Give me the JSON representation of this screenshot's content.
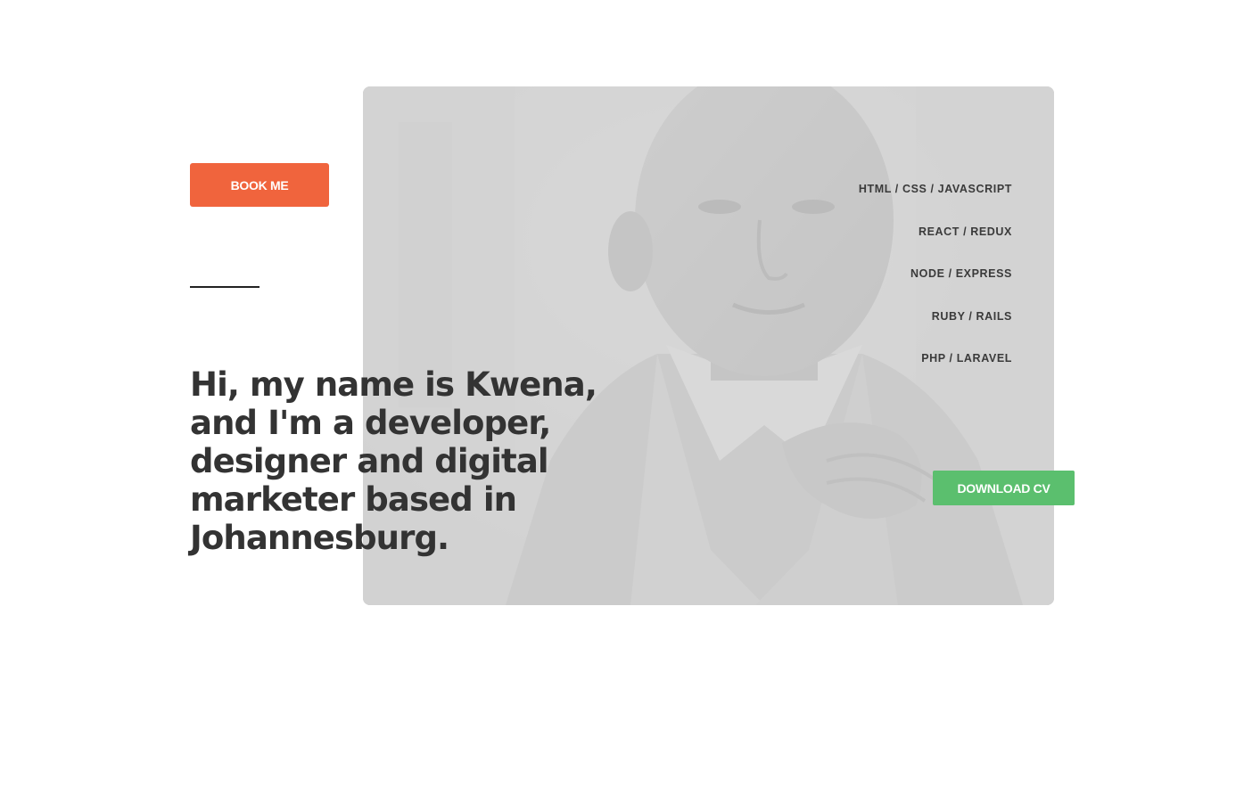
{
  "hero": {
    "book_label": "BOOK ME",
    "headline": "Hi, my name is Kwena, and I'm a developer, designer and digital marketer based in Johannesburg.",
    "download_label": "DOWNLOAD CV"
  },
  "skills": [
    "HTML / CSS / JAVASCRIPT",
    "REACT / REDUX",
    "NODE / EXPRESS",
    "RUBY / RAILS",
    "PHP / LARAVEL"
  ],
  "colors": {
    "book_button": "#f0643d",
    "download_button": "#5bbf6e",
    "headline_text": "#333333",
    "portrait_overlay": "#d3d3d3"
  }
}
